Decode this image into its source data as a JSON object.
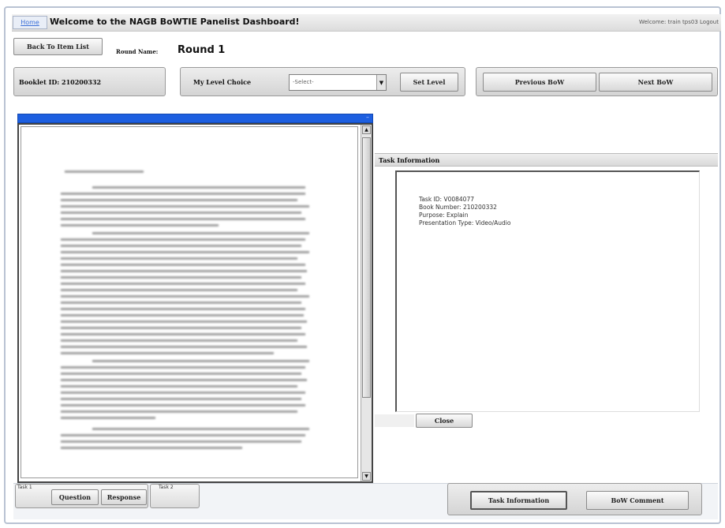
{
  "header": {
    "home_link": "Home",
    "title": "Welcome to the NAGB BoWTIE Panelist Dashboard!",
    "welcome_text": "Welcome: train tps03 Logout"
  },
  "toolbar": {
    "back_button": "Back To Item List",
    "round_label": "Round Name:",
    "round_value": "Round 1"
  },
  "booklet_bar": {
    "booklet_id": "Booklet ID: 210200332",
    "level_label": "My Level Choice",
    "level_select": "-Select-",
    "set_level_button": "Set Level",
    "previous_button": "Previous BoW",
    "next_button": "Next BoW"
  },
  "task_info": {
    "header": "Task Information",
    "lines": [
      "Task ID: V0084077",
      "Book Number: 210200332",
      "Purpose: Explain",
      "Presentation Type: Video/Audio"
    ],
    "close_button": "Close"
  },
  "bottom_tabs": {
    "task1_label": "Task 1",
    "question_button": "Question",
    "response_button": "Response",
    "task2_label": "Task 2"
  },
  "bottom_actions": {
    "task_info_button": "Task Information",
    "bow_comment_button": "BoW Comment"
  },
  "colors": {
    "doc_titlebar": "#1d5fe0",
    "accent_link": "#3a6fd8"
  }
}
